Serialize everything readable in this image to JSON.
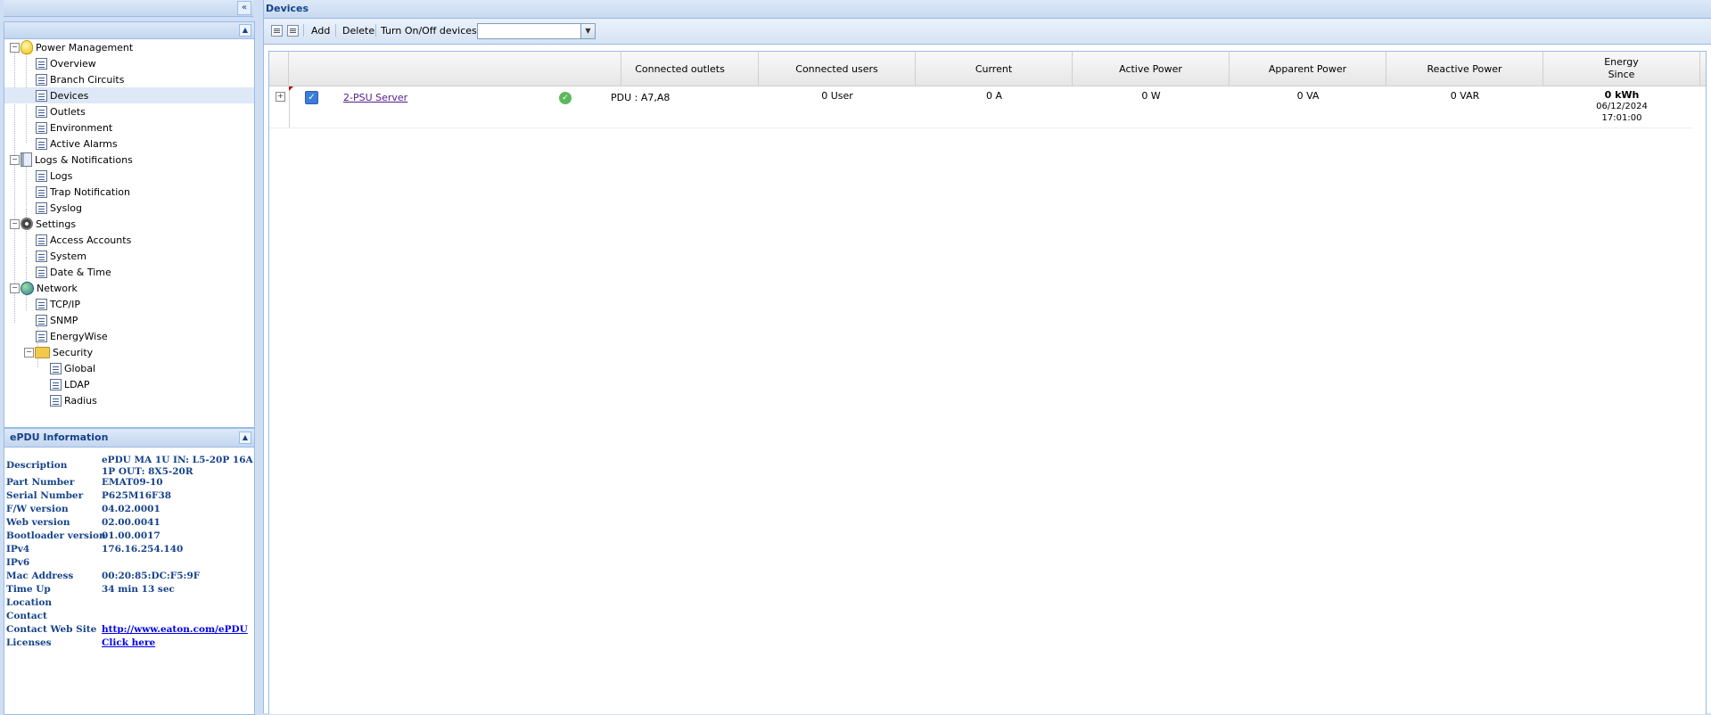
{
  "tree": {
    "nodes": [
      {
        "label": "Power Management",
        "icon": "lightbulb-icon"
      },
      {
        "label": "Overview"
      },
      {
        "label": "Branch Circuits"
      },
      {
        "label": "Devices"
      },
      {
        "label": "Outlets"
      },
      {
        "label": "Environment"
      },
      {
        "label": "Active Alarms"
      },
      {
        "label": "Logs & Notifications",
        "icon": "log-book-icon"
      },
      {
        "label": "Logs"
      },
      {
        "label": "Trap Notification"
      },
      {
        "label": "Syslog"
      },
      {
        "label": "Settings",
        "icon": "gears-icon"
      },
      {
        "label": "Access Accounts"
      },
      {
        "label": "System"
      },
      {
        "label": "Date & Time"
      },
      {
        "label": "Network",
        "icon": "globe-icon"
      },
      {
        "label": "TCP/IP"
      },
      {
        "label": "SNMP"
      },
      {
        "label": "EnergyWise"
      },
      {
        "label": "Security",
        "icon": "folder-icon"
      },
      {
        "label": "Global"
      },
      {
        "label": "LDAP"
      },
      {
        "label": "Radius"
      }
    ]
  },
  "info": {
    "title": "ePDU Information",
    "rows": [
      {
        "key": "Description",
        "value": "ePDU MA 1U IN: L5-20P 16A",
        "value2": "1P OUT: 8X5-20R"
      },
      {
        "key": "Part Number",
        "value": "EMAT09-10"
      },
      {
        "key": "Serial Number",
        "value": "P625M16F38"
      },
      {
        "key": "F/W version",
        "value": "04.02.0001"
      },
      {
        "key": "Web version",
        "value": "02.00.0041"
      },
      {
        "key": "Bootloader version",
        "value": "01.00.0017"
      },
      {
        "key": "IPv4",
        "value": "176.16.254.140"
      },
      {
        "key": "IPv6",
        "value": ""
      },
      {
        "key": "Mac Address",
        "value": "00:20:85:DC:F5:9F"
      },
      {
        "key": "Time Up",
        "value": "34 min 13 sec"
      },
      {
        "key": "Location",
        "value": ""
      },
      {
        "key": "Contact",
        "value": ""
      },
      {
        "key": "Contact Web Site",
        "value": "http://www.eaton.com/ePDU"
      },
      {
        "key": "Licenses",
        "value": "Click here"
      }
    ]
  },
  "main": {
    "title": "Devices",
    "toolbar": {
      "add": "Add",
      "delete": "Delete",
      "turn_label": "Turn On/Off devices :",
      "turn_value": ""
    },
    "columns": {
      "outlets": "Connected outlets",
      "users": "Connected users",
      "current": "Current",
      "active": "Active Power",
      "apparent": "Apparent Power",
      "reactive": "Reactive Power",
      "energy": "Energy",
      "energy2": "Since"
    },
    "rows": [
      {
        "name": "2-PSU Server",
        "checked": true,
        "status": "ok",
        "outlets": "PDU : A7,A8",
        "users": "0 User",
        "current": "0 A",
        "active": "0 W",
        "apparent": "0 VA",
        "reactive": "0 VAR",
        "energy": "0 kWh",
        "since_date": "06/12/2024",
        "since_time": "17:01:00"
      }
    ]
  },
  "colors": {
    "accent": "#15428b",
    "border": "#99bbe8",
    "selected": "#dfe8f6"
  }
}
